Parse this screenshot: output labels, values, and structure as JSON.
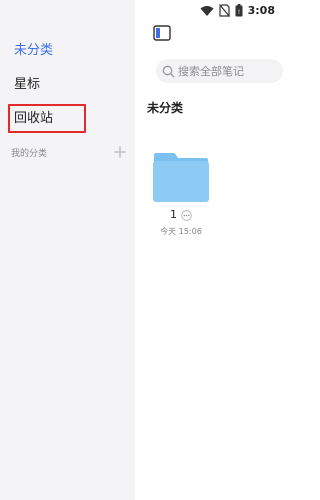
{
  "status_bar": {
    "time": "3:08"
  },
  "sidebar": {
    "items": [
      {
        "label": "未分类"
      },
      {
        "label": "星标"
      },
      {
        "label": "回收站"
      }
    ],
    "section_label": "我的分类"
  },
  "main": {
    "search_placeholder": "搜索全部笔记",
    "title": "未分类",
    "folders": [
      {
        "name": "1",
        "date": "今天 15:06"
      }
    ]
  },
  "colors": {
    "accent": "#3f6fe0",
    "highlight": "#e12b2b",
    "folder": "#8ccbf3"
  },
  "icons": [
    "wifi-icon",
    "no-sim-icon",
    "battery-icon",
    "sidebar-toggle-icon",
    "search-icon",
    "add-icon",
    "folder-icon",
    "more-icon"
  ]
}
